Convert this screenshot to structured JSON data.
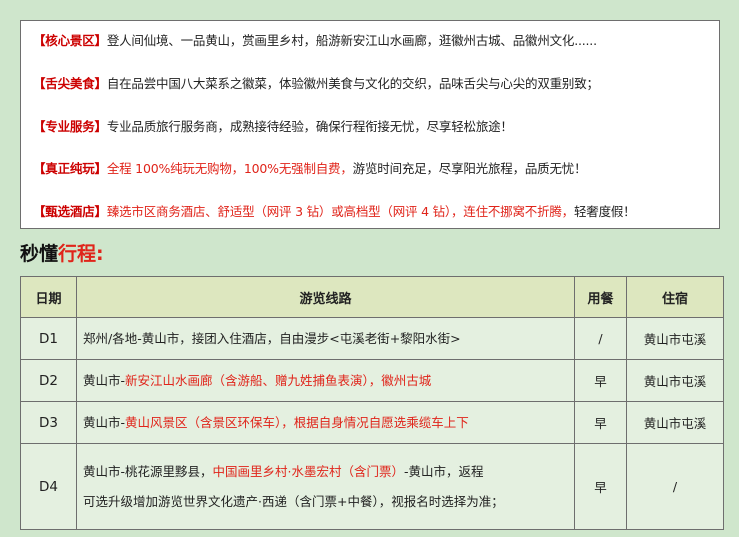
{
  "features": [
    {
      "tag": "【核心景区】",
      "text": "登人间仙境、一品黄山，赏画里乡村，船游新安江山水画廊，逛徽州古城、品徽州文化......",
      "red_text": "",
      "tail": ""
    },
    {
      "tag": "【舌尖美食】",
      "text": "自在品尝中国八大菜系之徽菜，体验徽州美食与文化的交织，品味舌尖与心尖的双重别致；",
      "red_text": "",
      "tail": ""
    },
    {
      "tag": "【专业服务】",
      "text": "专业品质旅行服务商，成熟接待经验，确保行程衔接无忧，尽享轻松旅途！",
      "red_text": "",
      "tail": ""
    },
    {
      "tag": "【真正纯玩】",
      "text": "",
      "red_text": "全程 100%纯玩无购物，100%无强制自费，",
      "tail": "游览时间充足，尽享阳光旅程，品质无忧！"
    },
    {
      "tag": "【甄选酒店】",
      "text": "",
      "red_text": "臻选市区商务酒店、舒适型（网评 3 钻）或高档型（网评 4 钻），连住不挪窝不折腾，",
      "tail": "轻奢度假！"
    }
  ],
  "section": {
    "title_prefix": "秒懂",
    "title_highlight": "行程",
    "title_suffix": ":"
  },
  "table": {
    "headers": {
      "day": "日期",
      "route": "游览线路",
      "meal": "用餐",
      "stay": "住宿"
    },
    "rows": [
      {
        "day": "D1",
        "route_a": "郑州/各地-黄山市，接团入住酒店，自由漫步<屯溪老街+黎阳水街>",
        "route_red": "",
        "route_b": "",
        "route_line2": "",
        "meal": "/",
        "stay": "黄山市屯溪"
      },
      {
        "day": "D2",
        "route_a": "黄山市-",
        "route_red": "新安江山水画廊（含游船、赠九姓捕鱼表演），徽州古城",
        "route_b": "",
        "route_line2": "",
        "meal": "早",
        "stay": "黄山市屯溪"
      },
      {
        "day": "D3",
        "route_a": "黄山市-",
        "route_red": "黄山风景区（含景区环保车），根据自身情况自愿选乘缆车上下",
        "route_b": "",
        "route_line2": "",
        "meal": "早",
        "stay": "黄山市屯溪"
      },
      {
        "day": "D4",
        "route_a": "黄山市-桃花源里黟县，",
        "route_red": "中国画里乡村·水墨宏村（含门票）",
        "route_b": "-黄山市，返程",
        "route_line2": "可选升级增加游览世界文化遗产·西递（含门票+中餐），视报名时选择为准；",
        "meal": "早",
        "stay": "/"
      }
    ]
  }
}
